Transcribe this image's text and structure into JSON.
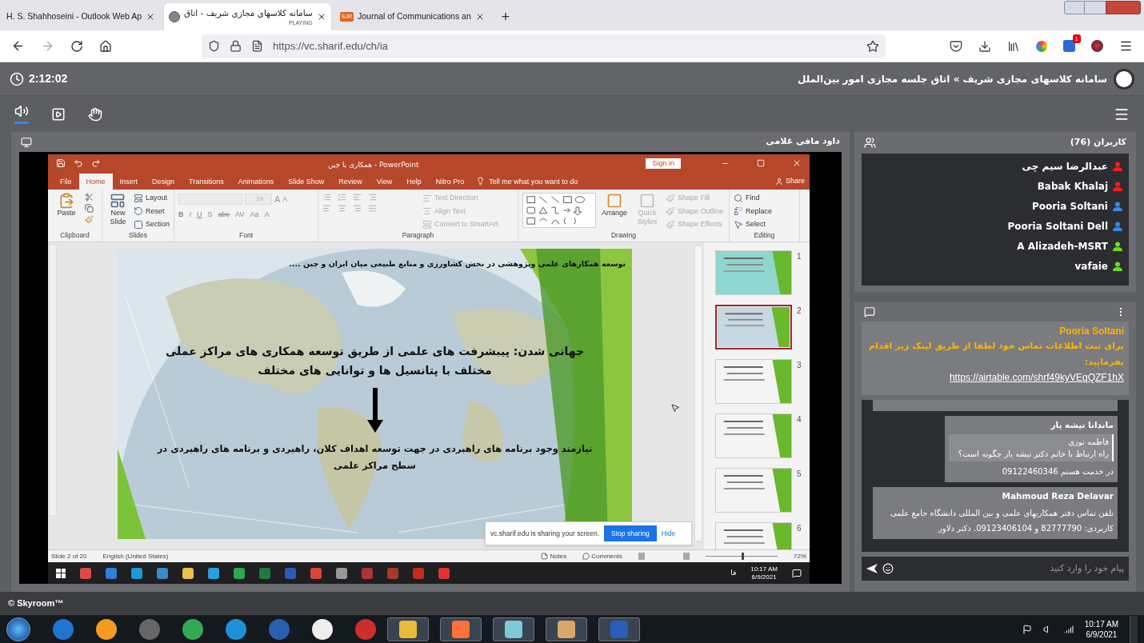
{
  "browser": {
    "tabs": [
      {
        "title": "H. S. Shahhoseini - Outlook Web Ap",
        "selected": false
      },
      {
        "title": "سامانه کلاسهای مجازی شریف - اتاق",
        "status": "PLAYING",
        "selected": true
      },
      {
        "title": "Journal of Communications an",
        "badge": "SJR",
        "selected": false
      }
    ],
    "new_tab": "+",
    "url": "https://vc.sharif.edu/ch/ia",
    "notification_count": "1"
  },
  "header": {
    "timer": "2:12:02",
    "breadcrumb": "سامانه کلاسهای مجازی شریف » اتاق جلسه مجازی امور بین‌الملل"
  },
  "presenter": {
    "name": "داود مافی غلامی"
  },
  "powerpoint": {
    "title": "همکاری با چین  -  PowerPoint",
    "sign_in": "Sign in",
    "share": "Share",
    "tell_me": "Tell me what you want to do",
    "tabs": [
      {
        "label": "File",
        "selected": false
      },
      {
        "label": "Home",
        "selected": true
      },
      {
        "label": "Insert",
        "selected": false
      },
      {
        "label": "Design",
        "selected": false
      },
      {
        "label": "Transitions",
        "selected": false
      },
      {
        "label": "Animations",
        "selected": false
      },
      {
        "label": "Slide Show",
        "selected": false
      },
      {
        "label": "Review",
        "selected": false
      },
      {
        "label": "View",
        "selected": false
      },
      {
        "label": "Help",
        "selected": false
      },
      {
        "label": "Nitro Pro",
        "selected": false
      }
    ],
    "groups": [
      {
        "kind": "clipboard",
        "label": "Clipboard",
        "commands": [
          {
            "label": "Paste",
            "disabled": false
          }
        ]
      },
      {
        "kind": "slides",
        "label": "Slides",
        "commands": [
          {
            "label": "New Slide",
            "disabled": false
          },
          {
            "label": "Layout",
            "disabled": false
          },
          {
            "label": "Reset",
            "disabled": false
          },
          {
            "label": "Section",
            "disabled": false
          }
        ]
      },
      {
        "kind": "font",
        "label": "Font",
        "font_size": "19",
        "size_buttons": [
          "A",
          "A"
        ],
        "buttons": [
          "B",
          "I",
          "U",
          "S",
          "abc",
          "AV",
          "Aa",
          "A"
        ]
      },
      {
        "kind": "paragraph",
        "label": "Paragraph",
        "commands": [
          {
            "label": "Text Direction",
            "disabled": true
          },
          {
            "label": "Align Text",
            "disabled": true
          },
          {
            "label": "Convert to SmartArt",
            "disabled": true
          }
        ]
      },
      {
        "kind": "drawing",
        "label": "Drawing",
        "commands": [
          {
            "label": "Arrange",
            "disabled": false
          },
          {
            "label": "Quick Styles",
            "disabled": true
          },
          {
            "label": "Shape Fill",
            "disabled": true
          },
          {
            "label": "Shape Outline",
            "disabled": true
          },
          {
            "label": "Shape Effects",
            "disabled": true
          }
        ]
      },
      {
        "kind": "editing",
        "label": "Editing",
        "commands": [
          {
            "label": "Find",
            "disabled": false
          },
          {
            "label": "Replace",
            "disabled": false
          },
          {
            "label": "Select",
            "disabled": false
          }
        ]
      }
    ],
    "slide": {
      "header": "توسعه همکارهای علمی وپژوهشی در بخش کشاورزی و منابع طبیعی میان ایران و چین ....",
      "title": "جهانی شدن: پیبشرفت های علمی از طریق توسعه همکاری های مراکز عملی مختلف با پتانسیل ها و توانایی های مختلف",
      "body": "نیازمند وجود برنامه های راهبردی در جهت توسعه اهداف کلان، راهبردی و برنامه های راهبردی در سطح مراکز علمی"
    },
    "thumbnails": [
      {
        "number": "1",
        "selected": false
      },
      {
        "number": "2",
        "selected": true
      },
      {
        "number": "3",
        "selected": false
      },
      {
        "number": "4",
        "selected": false
      },
      {
        "number": "5",
        "selected": false
      },
      {
        "number": "6",
        "selected": false
      }
    ],
    "status": {
      "slide": "Slide 2 of 20",
      "language": "English (United States)",
      "notes": "Notes",
      "comments": "Comments",
      "zoom": "72%",
      "zoom_slider": {
        "level": 0.5
      }
    },
    "sharing": {
      "message": "vc.sharif.edu is sharing your screen.",
      "stop": "Stop sharing",
      "hide": "Hide"
    },
    "taskbar": {
      "language": "فا",
      "time": "10:17 AM",
      "date": "6/9/2021"
    }
  },
  "users": {
    "title": "کاربران (76)",
    "items": [
      {
        "name": "عبدالرضا سیم چی",
        "color": "#ff1a1a"
      },
      {
        "name": "Babak Khalaj",
        "color": "#ff1a1a"
      },
      {
        "name": "Pooria Soltani",
        "color": "#2f8cf0"
      },
      {
        "name": "Pooria Soltani Dell",
        "color": "#2f8cf0"
      },
      {
        "name": "A Alizadeh-MSRT",
        "color": "#66e01c"
      },
      {
        "name": "vafaie",
        "color": "#66e01c"
      }
    ]
  },
  "chat": {
    "pinned": {
      "author": "Pooria Soltani",
      "text": "برای ثبت اطلاعات تماس خود لطفا از طریق لینک زیر اقدام بفرمایید:",
      "link": "https://airtable.com/shrf49kyVEqQZF1hX"
    },
    "messages": [
      {
        "author": "ماندانا تیشه یار",
        "quote": {
          "author": "فاطمه نوری",
          "text": "راه ارتباط با خانم دکتر تیشه یار چگونه است؟"
        },
        "text": "در خدمت هستم 09122460346"
      },
      {
        "author": "Mahmoud Reza Delavar",
        "text": "تلفن تماس دفتر همکاریهای علمی و بین المللی دانشگاه جامع علمی کاربردی: 82777790 و 09123406104. دکتر دلاور"
      }
    ],
    "placeholder": "پیام خود را وارد کنید"
  },
  "footer": "© Skyroom™",
  "taskbar": {
    "time": "10:17 AM",
    "date": "6/9/2021"
  }
}
